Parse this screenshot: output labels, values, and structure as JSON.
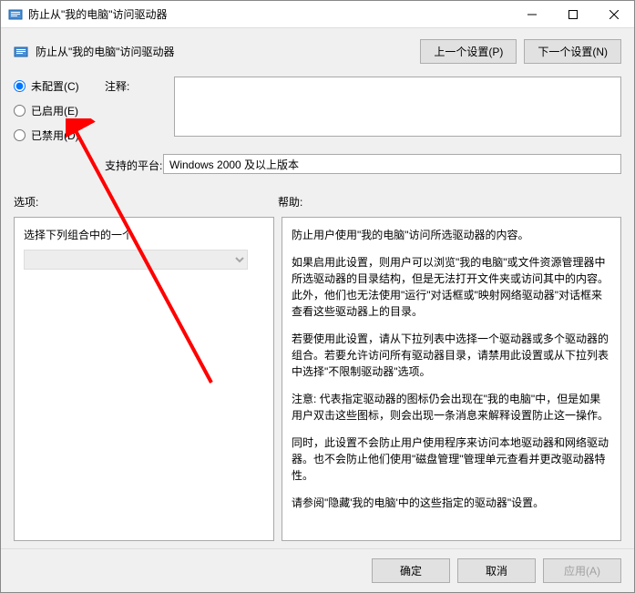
{
  "window": {
    "title": "防止从\"我的电脑\"访问驱动器"
  },
  "header": {
    "title": "防止从\"我的电脑\"访问驱动器",
    "prev_button": "上一个设置(P)",
    "next_button": "下一个设置(N)"
  },
  "config": {
    "not_configured": "未配置(C)",
    "enabled": "已启用(E)",
    "disabled": "已禁用(D)",
    "comment_label": "注释:",
    "comment_value": "",
    "platform_label": "支持的平台:",
    "platform_value": "Windows 2000 及以上版本"
  },
  "sections": {
    "options_label": "选项:",
    "help_label": "帮助:"
  },
  "options": {
    "dropdown_label": "选择下列组合中的一个",
    "dropdown_value": ""
  },
  "help": {
    "p1": "防止用户使用\"我的电脑\"访问所选驱动器的内容。",
    "p2": "如果启用此设置，则用户可以浏览\"我的电脑\"或文件资源管理器中所选驱动器的目录结构，但是无法打开文件夹或访问其中的内容。此外，他们也无法使用\"运行\"对话框或\"映射网络驱动器\"对话框来查看这些驱动器上的目录。",
    "p3": "若要使用此设置，请从下拉列表中选择一个驱动器或多个驱动器的组合。若要允许访问所有驱动器目录，请禁用此设置或从下拉列表中选择\"不限制驱动器\"选项。",
    "p4": "注意: 代表指定驱动器的图标仍会出现在\"我的电脑\"中，但是如果用户双击这些图标，则会出现一条消息来解释设置防止这一操作。",
    "p5": "同时，此设置不会防止用户使用程序来访问本地驱动器和网络驱动器。也不会防止他们使用\"磁盘管理\"管理单元查看并更改驱动器特性。",
    "p6": "请参阅\"隐藏'我的电脑'中的这些指定的驱动器\"设置。"
  },
  "footer": {
    "ok": "确定",
    "cancel": "取消",
    "apply": "应用(A)"
  }
}
